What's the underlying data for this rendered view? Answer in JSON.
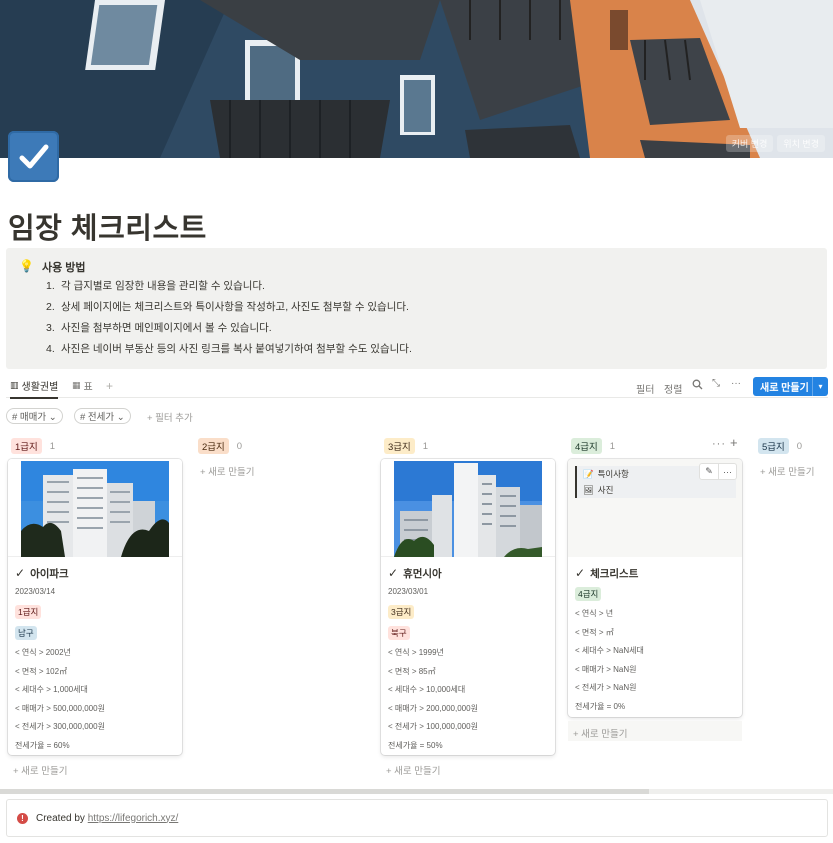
{
  "cover": {
    "buttons": [
      "커버 변경",
      "위치 변경"
    ]
  },
  "page": {
    "title": "임장 체크리스트",
    "icon": "checkbox-icon"
  },
  "callout": {
    "icon": "lightbulb-icon",
    "title": "사용 방법",
    "items": [
      {
        "num": "1.",
        "text": "각 급지별로 임장한 내용을 관리할 수 있습니다."
      },
      {
        "num": "2.",
        "text": "상세 페이지에는 체크리스트와 특이사항을 작성하고, 사진도 첨부할 수 있습니다."
      },
      {
        "num": "3.",
        "text": "사진을 첨부하면 메인페이지에서 볼 수 있습니다."
      },
      {
        "num": "4.",
        "text": "사진은 네이버 부동산 등의 사진 링크를 복사 붙여넣기하여 첨부할 수도 있습니다."
      }
    ]
  },
  "views": {
    "tabs": [
      {
        "label": "생활권별",
        "icon": "board-icon"
      },
      {
        "label": "표",
        "icon": "table-icon"
      }
    ],
    "add": "+",
    "tools": {
      "filter": "필터",
      "sort": "정렬",
      "more": "···"
    },
    "new_button": "새로 만들기"
  },
  "filters": {
    "chips": [
      "# 매매가 ⌄",
      "# 전세가 ⌄"
    ],
    "add_filter": "+ 필터 추가"
  },
  "board": {
    "columns": [
      {
        "label": "1급지",
        "count": "1",
        "bg": "#ffe2dd",
        "fg": "#5d1715"
      },
      {
        "label": "2급지",
        "count": "0",
        "bg": "#fadec9",
        "fg": "#49290e"
      },
      {
        "label": "3급지",
        "count": "1",
        "bg": "#fdecc8",
        "fg": "#402c1b"
      },
      {
        "label": "4급지",
        "count": "1",
        "bg": "#dbeddb",
        "fg": "#1c3829"
      },
      {
        "label": "5급지",
        "count": "0",
        "bg": "#d3e5ef",
        "fg": "#183347"
      }
    ],
    "new_card": "+ 새로 만들기",
    "column_more": "···",
    "column_add": "+",
    "cards": [
      {
        "title": "아이파크",
        "date": "2023/03/14",
        "grade": "1급지",
        "district": "남구",
        "props": [
          "< 연식 > 2002년",
          "< 면적 > 102㎡",
          "< 세대수 > 1,000세대",
          "< 매매가 > 500,000,000원",
          "< 전세가 > 300,000,000원",
          "전세가율 = 60%"
        ]
      },
      {
        "title": "휴먼시아",
        "date": "2023/03/01",
        "grade": "3급지",
        "district": "북구",
        "props": [
          "< 연식 > 1999년",
          "< 면적 > 85㎡",
          "< 세대수 > 10,000세대",
          "< 매매가 > 200,000,000원",
          "< 전세가 > 100,000,000원",
          "전세가율 = 50%"
        ]
      },
      {
        "title": "체크리스트",
        "grade": "4급지",
        "links": [
          {
            "icon": "memo-icon",
            "label": "특이사항"
          },
          {
            "icon": "photo-icon",
            "label": "사진"
          }
        ],
        "props": [
          "< 연식 > 년",
          "< 면적 > ㎡",
          "< 세대수 > NaN세대",
          "< 매매가 > NaN원",
          "< 전세가 > NaN원",
          "전세가율 = 0%"
        ]
      }
    ]
  },
  "footer": {
    "prefix": "Created by",
    "link": "https://lifegorich.xyz/"
  },
  "colors": {
    "accent": "#2383e2",
    "tag_red_bg": "#ffe2dd",
    "tag_blue_bg": "#d3e5ef",
    "tag_yellow_bg": "#fdecc8",
    "tag_green_bg": "#dbeddb"
  }
}
